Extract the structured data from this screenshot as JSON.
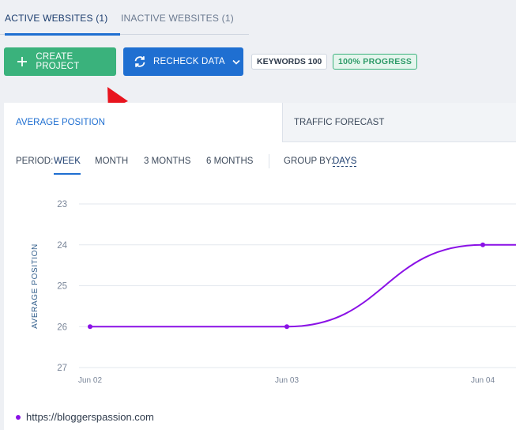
{
  "tabs": {
    "active": "ACTIVE WEBSITES (1)",
    "inactive": "INACTIVE WEBSITES (1)"
  },
  "toolbar": {
    "create_label": "CREATE PROJECT",
    "recheck_label": "RECHECK DATA",
    "keywords_badge": "KEYWORDS 100",
    "progress_badge": "100%  PROGRESS",
    "icons": {
      "create": "plus-icon",
      "recheck": "refresh-icon",
      "dropdown": "chevron-down-icon"
    }
  },
  "panel": {
    "tabs": {
      "active": "AVERAGE POSITION",
      "inactive": "TRAFFIC FORECAST"
    },
    "filters": {
      "period_label": "PERIOD:",
      "periods": [
        "WEEK",
        "MONTH",
        "3 MONTHS",
        "6 MONTHS"
      ],
      "selected_period": "WEEK",
      "group_by_label": "GROUP BY:",
      "group_by_value": "DAYS"
    }
  },
  "chart_data": {
    "type": "line",
    "ylabel": "AVERAGE POSITION",
    "xlabel": "",
    "y_ticks": [
      23,
      24,
      25,
      26,
      27
    ],
    "ylim": [
      27,
      23
    ],
    "y_inverted": true,
    "x_ticks": [
      "Jun 02",
      "Jun 03",
      "Jun 04"
    ],
    "grid": true,
    "series": [
      {
        "name": "https://bloggerspassion.com",
        "color": "#8a11e6",
        "x": [
          "Jun 02",
          "Jun 03",
          "Jun 04"
        ],
        "values": [
          26,
          26,
          24
        ]
      }
    ],
    "legend": "bottom-left"
  },
  "colors": {
    "accent": "#1f6fd1",
    "success": "#3ab27c",
    "series": "#8a11e6",
    "annotation": "#e8141e"
  }
}
